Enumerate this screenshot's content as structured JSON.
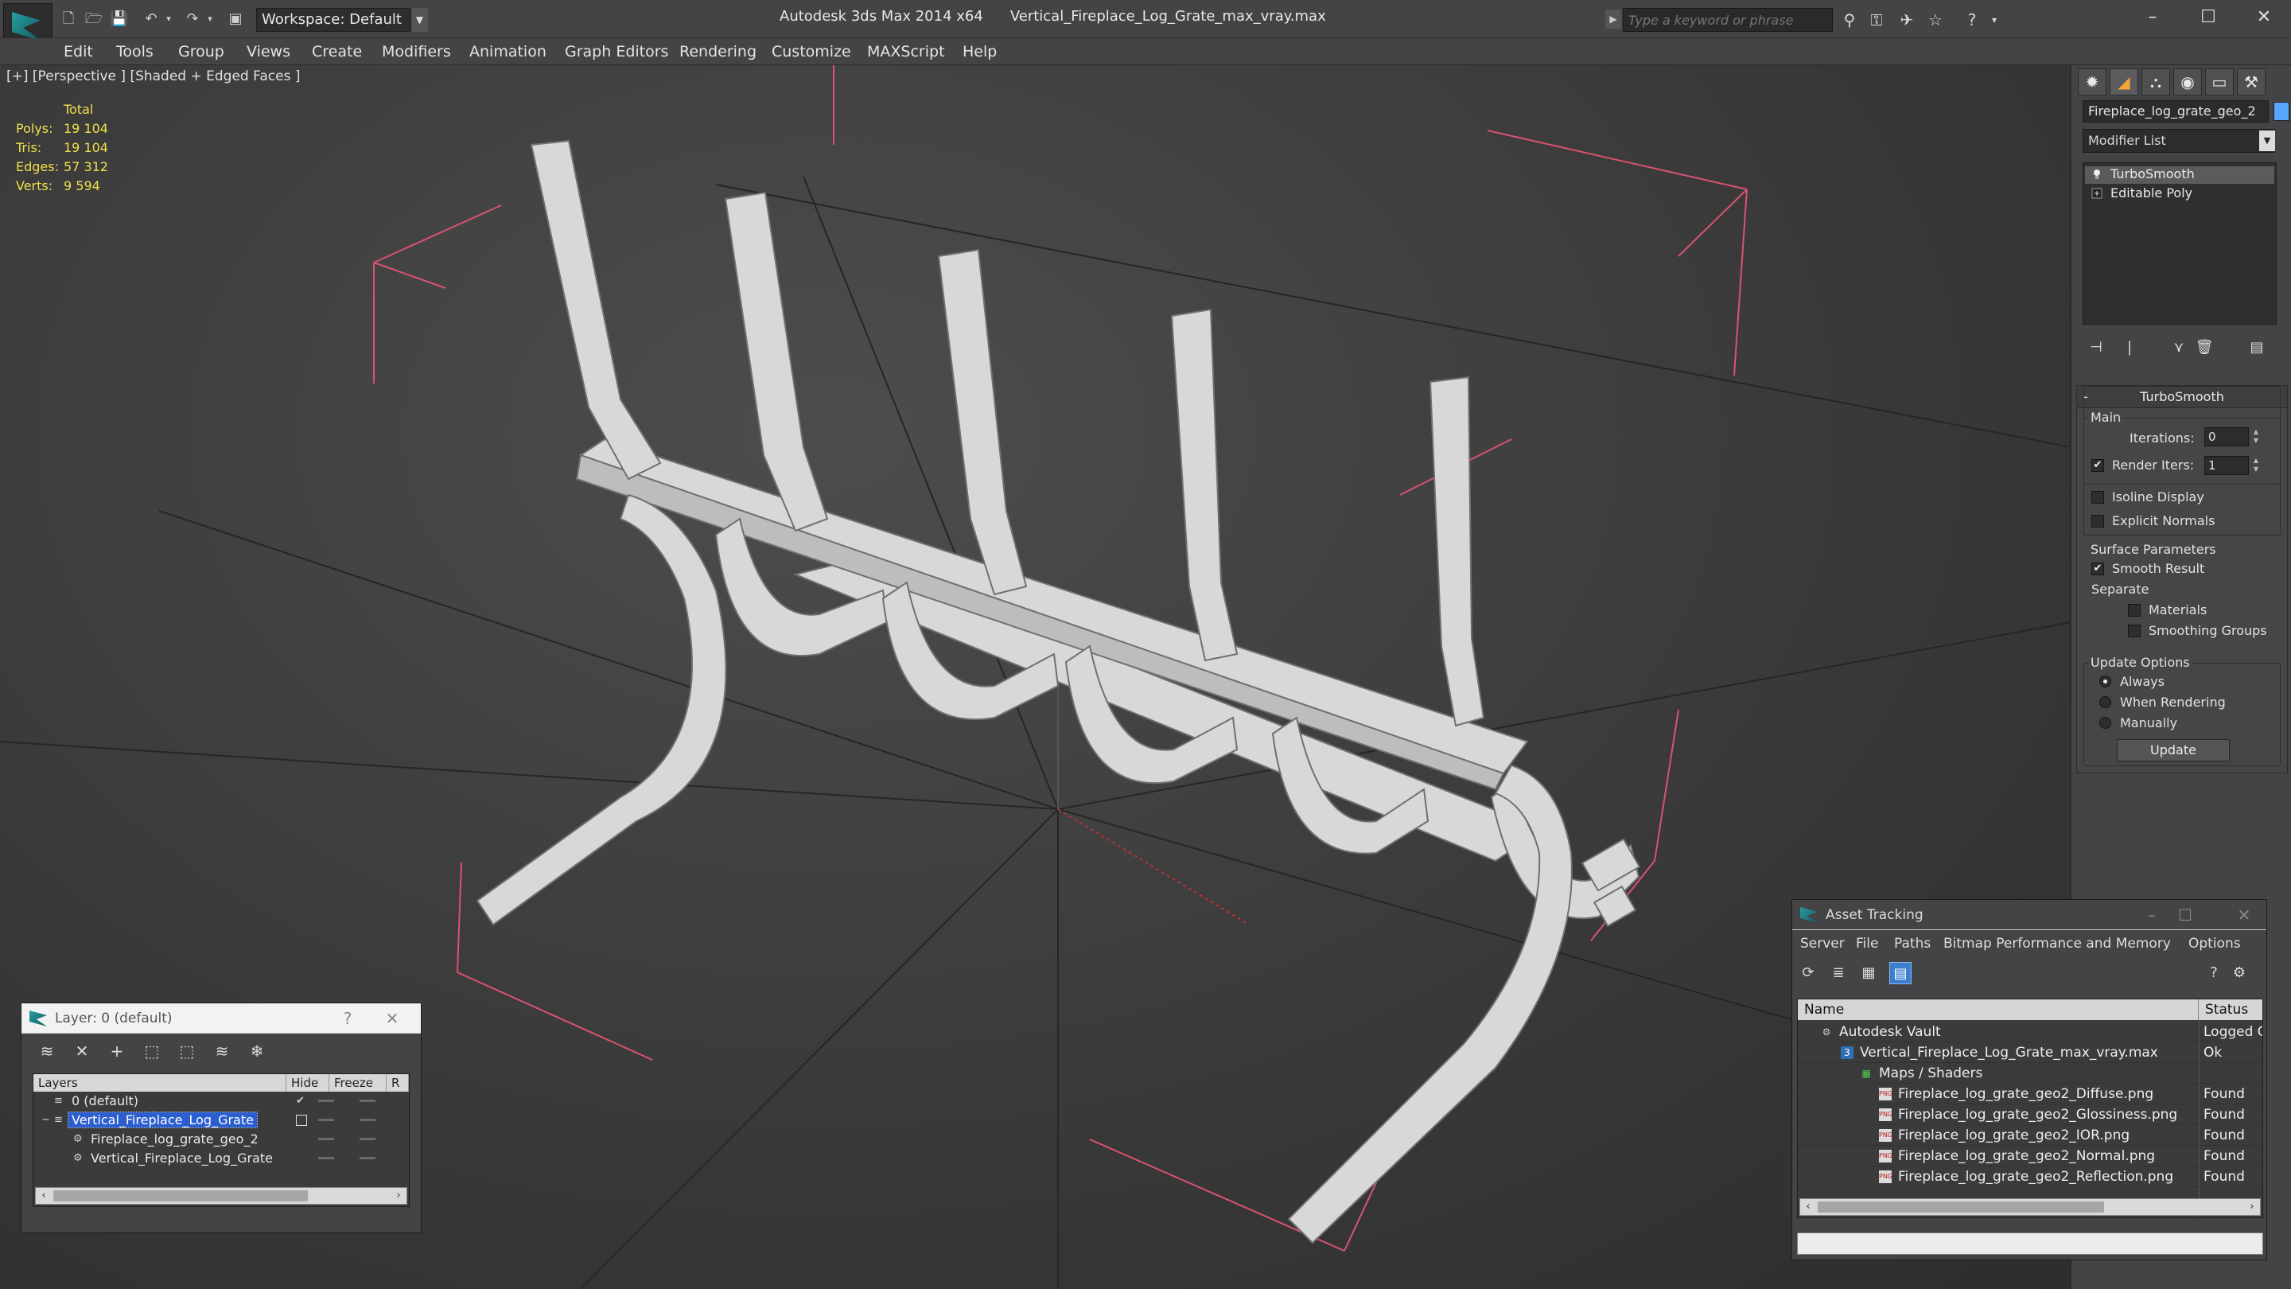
{
  "titlebar": {
    "workspace": "Workspace: Default",
    "app_name": "Autodesk 3ds Max  2014 x64",
    "file_name": "Vertical_Fireplace_Log_Grate_max_vray.max",
    "search_placeholder": "Type a keyword or phrase"
  },
  "menu": [
    "Edit",
    "Tools",
    "Group",
    "Views",
    "Create",
    "Modifiers",
    "Animation",
    "Graph Editors",
    "Rendering",
    "Customize",
    "MAXScript",
    "Help"
  ],
  "viewport": {
    "label": "[+] [Perspective ] [Shaded + Edged Faces ]",
    "stats": {
      "header": "Total",
      "rows": [
        {
          "k": "Polys:",
          "v": "19 104"
        },
        {
          "k": "Tris:",
          "v": "19 104"
        },
        {
          "k": "Edges:",
          "v": "57 312"
        },
        {
          "k": "Verts:",
          "v": "9 594"
        }
      ]
    }
  },
  "command_panel": {
    "object_name": "Fireplace_log_grate_geo_2",
    "modifier_list": "Modifier List",
    "stack": [
      "TurboSmooth",
      "Editable Poly"
    ],
    "turbosmooth": {
      "title": "TurboSmooth",
      "main": "Main",
      "iterations_label": "Iterations:",
      "iterations_value": "0",
      "render_iters_label": "Render Iters:",
      "render_iters_value": "1",
      "isoline": "Isoline Display",
      "explicit_normals": "Explicit Normals",
      "surface_params": "Surface Parameters",
      "smooth_result": "Smooth Result",
      "separate": "Separate",
      "materials": "Materials",
      "smoothing_groups": "Smoothing Groups",
      "update_options": "Update Options",
      "always": "Always",
      "when_rendering": "When Rendering",
      "manually": "Manually",
      "update_button": "Update"
    }
  },
  "layer_window": {
    "title": "Layer: 0 (default)",
    "help": "?",
    "columns": [
      "Layers",
      "Hide",
      "Freeze",
      "R"
    ],
    "rows": [
      {
        "name": "0 (default)",
        "selected": false,
        "indent": 0
      },
      {
        "name": "Vertical_Fireplace_Log_Grate",
        "selected": true,
        "indent": 0
      },
      {
        "name": "Fireplace_log_grate_geo_2",
        "selected": false,
        "indent": 1
      },
      {
        "name": "Vertical_Fireplace_Log_Grate",
        "selected": false,
        "indent": 1
      }
    ]
  },
  "asset_window": {
    "title": "Asset Tracking",
    "menu": [
      "Server",
      "File",
      "Paths",
      "Bitmap Performance and Memory",
      "Options"
    ],
    "columns": [
      "Name",
      "Status"
    ],
    "rows": [
      {
        "name": "Autodesk Vault",
        "status": "Logged O",
        "indent": 0,
        "icon": "vault-icon"
      },
      {
        "name": "Vertical_Fireplace_Log_Grate_max_vray.max",
        "status": "Ok",
        "indent": 1,
        "icon": "max-file-icon"
      },
      {
        "name": "Maps / Shaders",
        "status": "",
        "indent": 2,
        "icon": "maps-icon"
      },
      {
        "name": "Fireplace_log_grate_geo2_Diffuse.png",
        "status": "Found",
        "indent": 3,
        "icon": "png-icon"
      },
      {
        "name": "Fireplace_log_grate_geo2_Glossiness.png",
        "status": "Found",
        "indent": 3,
        "icon": "png-icon"
      },
      {
        "name": "Fireplace_log_grate_geo2_IOR.png",
        "status": "Found",
        "indent": 3,
        "icon": "png-icon"
      },
      {
        "name": "Fireplace_log_grate_geo2_Normal.png",
        "status": "Found",
        "indent": 3,
        "icon": "png-icon"
      },
      {
        "name": "Fireplace_log_grate_geo2_Reflection.png",
        "status": "Found",
        "indent": 3,
        "icon": "png-icon"
      }
    ]
  }
}
